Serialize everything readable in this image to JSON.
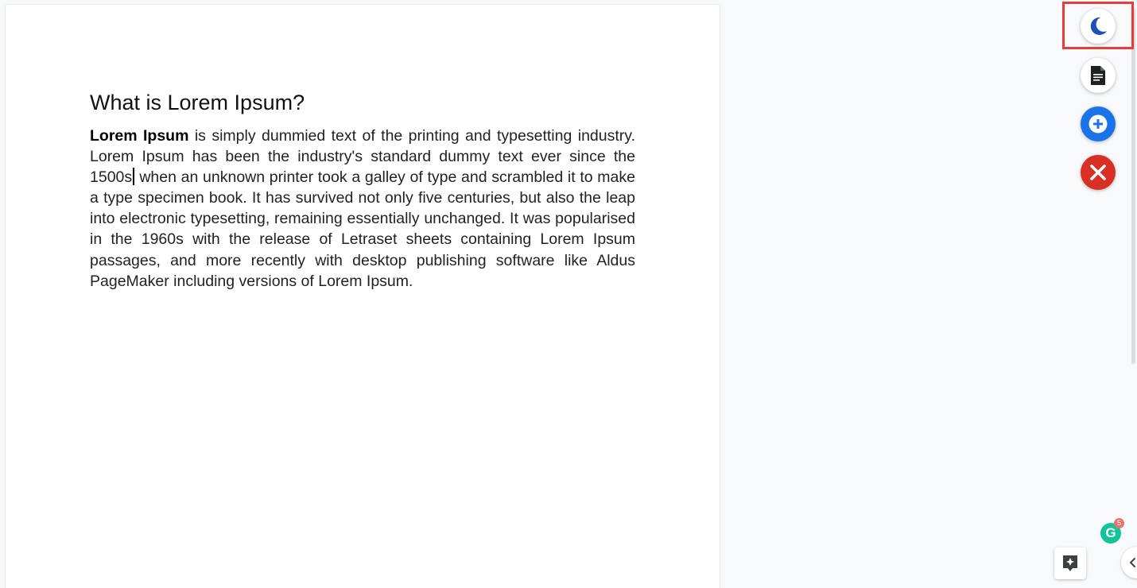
{
  "document": {
    "heading": "What is Lorem Ipsum?",
    "paragraph": {
      "bold_lead": "Lorem Ipsum",
      "text_before_caret": " is simply dummied text of the printing and typesetting industry. Lorem Ipsum has been the industry's standard dummy text ever since the 1500s",
      "text_after_caret": " when an unknown printer took a galley of type and scrambled it to make a type specimen book. It has survived not only five centuries, but also the leap into electronic typesetting, remaining essentially unchanged. It was popularised in the 1960s with the release of Letraset sheets containing Lorem Ipsum passages, and more recently with desktop publishing software like Aldus PageMaker including versions of Lorem Ipsum."
    }
  },
  "floating_buttons": [
    {
      "icon": "moon-icon",
      "color": "#1e4fb8"
    },
    {
      "icon": "document-icon",
      "color": "#202124"
    },
    {
      "icon": "plus-circle-icon",
      "color": "#1a73e8"
    },
    {
      "icon": "close-icon",
      "color": "#d93025"
    }
  ],
  "grammarly": {
    "letter": "G",
    "badge_count": "5"
  },
  "colors": {
    "highlight": "#ea3b3b",
    "page_bg": "#f8f9fa"
  }
}
